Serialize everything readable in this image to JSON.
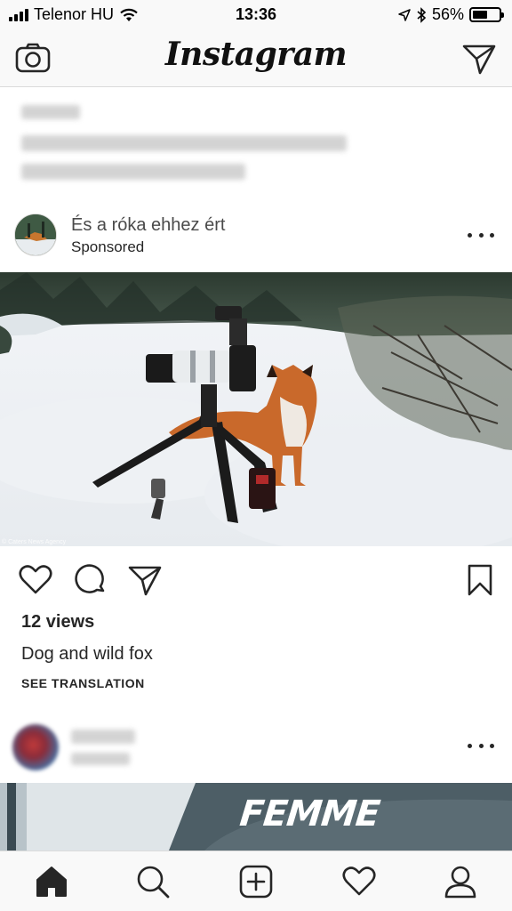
{
  "status_bar": {
    "carrier": "Telenor HU",
    "time": "13:36",
    "battery": "56%",
    "battery_level": 0.56
  },
  "header": {
    "logo": "Instagram",
    "left_icon": "camera-icon",
    "right_icon": "direct-message-icon"
  },
  "post": {
    "username": "És a róka ehhez ért",
    "subtitle": "Sponsored",
    "image_credit": "© Caters News Agency",
    "views": "12 views",
    "caption": "Dog and wild fox",
    "see_translation": "SEE TRANSLATION",
    "actions": [
      "heart-icon",
      "comment-icon",
      "share-icon",
      "bookmark-icon"
    ]
  },
  "next_post": {
    "image_text": "FEMME"
  },
  "tab_bar": {
    "items": [
      "home-icon",
      "search-icon",
      "add-post-icon",
      "activity-heart-icon",
      "profile-icon"
    ]
  },
  "colors": {
    "bar_background": "#f9f9f9",
    "text": "#262626",
    "divider": "#dbdbdb"
  }
}
